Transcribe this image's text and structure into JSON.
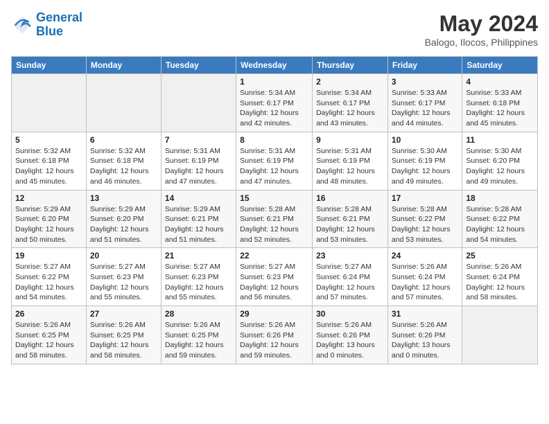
{
  "logo": {
    "line1": "General",
    "line2": "Blue"
  },
  "title": {
    "month_year": "May 2024",
    "location": "Balogo, Ilocos, Philippines"
  },
  "days_of_week": [
    "Sunday",
    "Monday",
    "Tuesday",
    "Wednesday",
    "Thursday",
    "Friday",
    "Saturday"
  ],
  "weeks": [
    [
      {
        "day": "",
        "info": ""
      },
      {
        "day": "",
        "info": ""
      },
      {
        "day": "",
        "info": ""
      },
      {
        "day": "1",
        "info": "Sunrise: 5:34 AM\nSunset: 6:17 PM\nDaylight: 12 hours\nand 42 minutes."
      },
      {
        "day": "2",
        "info": "Sunrise: 5:34 AM\nSunset: 6:17 PM\nDaylight: 12 hours\nand 43 minutes."
      },
      {
        "day": "3",
        "info": "Sunrise: 5:33 AM\nSunset: 6:17 PM\nDaylight: 12 hours\nand 44 minutes."
      },
      {
        "day": "4",
        "info": "Sunrise: 5:33 AM\nSunset: 6:18 PM\nDaylight: 12 hours\nand 45 minutes."
      }
    ],
    [
      {
        "day": "5",
        "info": "Sunrise: 5:32 AM\nSunset: 6:18 PM\nDaylight: 12 hours\nand 45 minutes."
      },
      {
        "day": "6",
        "info": "Sunrise: 5:32 AM\nSunset: 6:18 PM\nDaylight: 12 hours\nand 46 minutes."
      },
      {
        "day": "7",
        "info": "Sunrise: 5:31 AM\nSunset: 6:19 PM\nDaylight: 12 hours\nand 47 minutes."
      },
      {
        "day": "8",
        "info": "Sunrise: 5:31 AM\nSunset: 6:19 PM\nDaylight: 12 hours\nand 47 minutes."
      },
      {
        "day": "9",
        "info": "Sunrise: 5:31 AM\nSunset: 6:19 PM\nDaylight: 12 hours\nand 48 minutes."
      },
      {
        "day": "10",
        "info": "Sunrise: 5:30 AM\nSunset: 6:19 PM\nDaylight: 12 hours\nand 49 minutes."
      },
      {
        "day": "11",
        "info": "Sunrise: 5:30 AM\nSunset: 6:20 PM\nDaylight: 12 hours\nand 49 minutes."
      }
    ],
    [
      {
        "day": "12",
        "info": "Sunrise: 5:29 AM\nSunset: 6:20 PM\nDaylight: 12 hours\nand 50 minutes."
      },
      {
        "day": "13",
        "info": "Sunrise: 5:29 AM\nSunset: 6:20 PM\nDaylight: 12 hours\nand 51 minutes."
      },
      {
        "day": "14",
        "info": "Sunrise: 5:29 AM\nSunset: 6:21 PM\nDaylight: 12 hours\nand 51 minutes."
      },
      {
        "day": "15",
        "info": "Sunrise: 5:28 AM\nSunset: 6:21 PM\nDaylight: 12 hours\nand 52 minutes."
      },
      {
        "day": "16",
        "info": "Sunrise: 5:28 AM\nSunset: 6:21 PM\nDaylight: 12 hours\nand 53 minutes."
      },
      {
        "day": "17",
        "info": "Sunrise: 5:28 AM\nSunset: 6:22 PM\nDaylight: 12 hours\nand 53 minutes."
      },
      {
        "day": "18",
        "info": "Sunrise: 5:28 AM\nSunset: 6:22 PM\nDaylight: 12 hours\nand 54 minutes."
      }
    ],
    [
      {
        "day": "19",
        "info": "Sunrise: 5:27 AM\nSunset: 6:22 PM\nDaylight: 12 hours\nand 54 minutes."
      },
      {
        "day": "20",
        "info": "Sunrise: 5:27 AM\nSunset: 6:23 PM\nDaylight: 12 hours\nand 55 minutes."
      },
      {
        "day": "21",
        "info": "Sunrise: 5:27 AM\nSunset: 6:23 PM\nDaylight: 12 hours\nand 55 minutes."
      },
      {
        "day": "22",
        "info": "Sunrise: 5:27 AM\nSunset: 6:23 PM\nDaylight: 12 hours\nand 56 minutes."
      },
      {
        "day": "23",
        "info": "Sunrise: 5:27 AM\nSunset: 6:24 PM\nDaylight: 12 hours\nand 57 minutes."
      },
      {
        "day": "24",
        "info": "Sunrise: 5:26 AM\nSunset: 6:24 PM\nDaylight: 12 hours\nand 57 minutes."
      },
      {
        "day": "25",
        "info": "Sunrise: 5:26 AM\nSunset: 6:24 PM\nDaylight: 12 hours\nand 58 minutes."
      }
    ],
    [
      {
        "day": "26",
        "info": "Sunrise: 5:26 AM\nSunset: 6:25 PM\nDaylight: 12 hours\nand 58 minutes."
      },
      {
        "day": "27",
        "info": "Sunrise: 5:26 AM\nSunset: 6:25 PM\nDaylight: 12 hours\nand 58 minutes."
      },
      {
        "day": "28",
        "info": "Sunrise: 5:26 AM\nSunset: 6:25 PM\nDaylight: 12 hours\nand 59 minutes."
      },
      {
        "day": "29",
        "info": "Sunrise: 5:26 AM\nSunset: 6:26 PM\nDaylight: 12 hours\nand 59 minutes."
      },
      {
        "day": "30",
        "info": "Sunrise: 5:26 AM\nSunset: 6:26 PM\nDaylight: 13 hours\nand 0 minutes."
      },
      {
        "day": "31",
        "info": "Sunrise: 5:26 AM\nSunset: 6:26 PM\nDaylight: 13 hours\nand 0 minutes."
      },
      {
        "day": "",
        "info": ""
      }
    ]
  ]
}
